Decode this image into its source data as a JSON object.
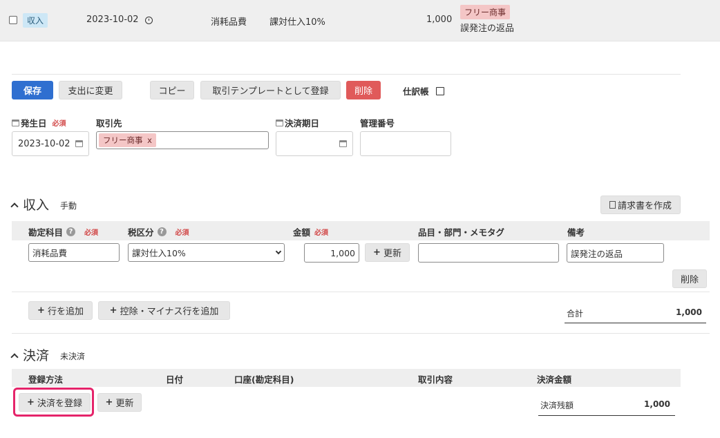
{
  "summary": {
    "type_tag": "収入",
    "date": "2023-10-02",
    "account": "消耗品費",
    "tax": "課対仕入10%",
    "amount": "1,000",
    "partner_tag": "フリー商事",
    "memo": "誤発注の返品"
  },
  "toolbar": {
    "save": "保存",
    "change_to_expense": "支出に変更",
    "copy": "コピー",
    "register_template": "取引テンプレートとして登録",
    "delete": "削除",
    "journal": "仕訳帳"
  },
  "form": {
    "issue_date_label": "発生日",
    "required": "必須",
    "issue_date_value": "2023-10-02",
    "partner_label": "取引先",
    "partner_chip": "フリー商事",
    "partner_chip_remove": "x",
    "due_date_label": "決済期日",
    "due_date_value": "",
    "control_no_label": "管理番号",
    "control_no_value": ""
  },
  "income": {
    "title": "収入",
    "mode": "手動",
    "invoice_button": "請求書を作成",
    "headers": {
      "account": "勘定科目",
      "tax": "税区分",
      "amount": "金額",
      "item": "品目・部門・メモタグ",
      "remarks": "備考"
    },
    "required": "必須",
    "row": {
      "account": "消耗品費",
      "tax": "課対仕入10%",
      "amount": "1,000",
      "update": "更新",
      "item": "",
      "remarks": "誤発注の返品",
      "delete": "削除"
    },
    "add_row": "行を追加",
    "add_deduction_row": "控除・マイナス行を追加",
    "total_label": "合計",
    "total_value": "1,000"
  },
  "settlement": {
    "title": "決済",
    "status": "未決済",
    "headers": {
      "method": "登録方法",
      "date": "日付",
      "account": "口座(勘定科目)",
      "content": "取引内容",
      "amount": "決済金額"
    },
    "register_button": "決済を登録",
    "update_button": "更新",
    "remaining_label": "決済残額",
    "remaining_value": "1,000"
  },
  "colors": {
    "primary": "#2f6fd0",
    "danger": "#e05a5a",
    "highlight": "#e5246a",
    "partner_tag_bg": "#f4c6c6",
    "income_tag_bg": "#cde7f6"
  }
}
